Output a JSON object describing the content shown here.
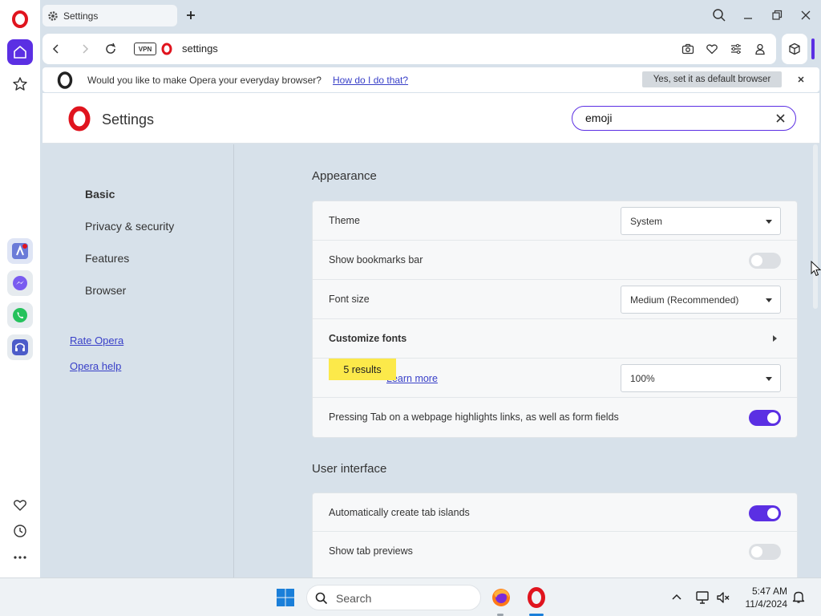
{
  "browser": {
    "tab_title": "Settings",
    "address": "settings",
    "vpn_label": "VPN"
  },
  "infobar": {
    "message": "Would you like to make Opera your everyday browser?",
    "link": "How do I do that?",
    "button": "Yes, set it as default browser"
  },
  "settings": {
    "title": "Settings",
    "search_value": "emoji",
    "nav": {
      "items": [
        "Basic",
        "Privacy & security",
        "Features",
        "Browser"
      ],
      "links": [
        "Rate Opera",
        "Opera help"
      ]
    },
    "appearance": {
      "title": "Appearance",
      "theme_label": "Theme",
      "theme_value": "System",
      "bookmarks_label": "Show bookmarks bar",
      "bookmarks_on": false,
      "font_size_label": "Font size",
      "font_size_value": "Medium (Recommended)",
      "customize_fonts_label": "Customize fonts",
      "results_badge": "5 results",
      "page_zoom_learn_more": "Learn more",
      "page_zoom_value": "100%",
      "tab_highlight_label": "Pressing Tab on a webpage highlights links, as well as form fields",
      "tab_highlight_on": true
    },
    "user_interface": {
      "title": "User interface",
      "tab_islands_label": "Automatically create tab islands",
      "tab_islands_on": true,
      "tab_previews_label": "Show tab previews",
      "tab_previews_on": false
    }
  },
  "taskbar": {
    "search_placeholder": "Search",
    "time": "5:47 AM",
    "date": "11/4/2024"
  },
  "colors": {
    "accent": "#5b2fe3",
    "opera_red": "#e0141e",
    "highlight": "#fce94a",
    "link": "#3940c8"
  }
}
